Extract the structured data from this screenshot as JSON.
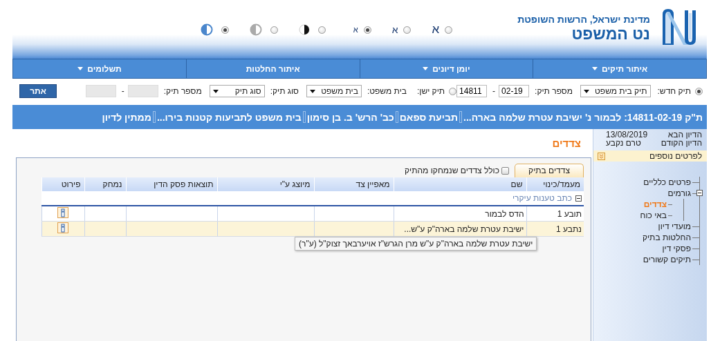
{
  "header": {
    "title": "נט המשפט",
    "subtitle": "מדינת ישראל, הרשות השופטת",
    "font_sizes": [
      {
        "label": "א",
        "kind": "large",
        "selected": false
      },
      {
        "label": "א",
        "kind": "medium",
        "selected": false
      },
      {
        "label": "א",
        "kind": "small",
        "selected": true
      }
    ],
    "contrast": [
      {
        "kind": "inverted",
        "selected": false
      },
      {
        "kind": "grayscale",
        "selected": false
      },
      {
        "kind": "normal",
        "selected": true
      }
    ]
  },
  "menu": [
    {
      "label": "איתור תיקים",
      "dropdown": true
    },
    {
      "label": "יומן דיונים",
      "dropdown": true
    },
    {
      "label": "איתור החלטות",
      "dropdown": false
    },
    {
      "label": "תשלומים",
      "dropdown": true
    }
  ],
  "search": {
    "items": [
      {
        "kind": "radio",
        "label": "תיק חדש:",
        "selected": true
      },
      {
        "kind": "select",
        "value": "תיק בית משפט"
      },
      {
        "kind": "label",
        "label": "מספר תיק:"
      },
      {
        "kind": "input",
        "value": "02-19",
        "disabled": false
      },
      {
        "kind": "label",
        "label": "-"
      },
      {
        "kind": "input",
        "value": "14811",
        "disabled": false
      },
      {
        "kind": "radio",
        "label": "תיק ישן:",
        "selected": false
      },
      {
        "kind": "label",
        "label": "בית משפט:"
      },
      {
        "kind": "select",
        "value": "בית משפט"
      },
      {
        "kind": "label",
        "label": "סוג תיק:"
      },
      {
        "kind": "select",
        "value": "סוג תיק"
      },
      {
        "kind": "label",
        "label": "מספר תיק:"
      },
      {
        "kind": "input",
        "value": "",
        "disabled": true
      },
      {
        "kind": "label",
        "label": "-"
      },
      {
        "kind": "input",
        "value": "",
        "disabled": true
      },
      {
        "kind": "button",
        "label": "אתר"
      }
    ]
  },
  "case_bar": [
    "ת\"ק 14811-02-19: לבמור נ' ישיבת עטרת שלמה בארה...",
    "תביעת ספאם",
    "כב' הרש' ב. בן סימון",
    "בית משפט לתביעות קטנות בירו...",
    "ממתין לדיון"
  ],
  "section_title": "צדדים",
  "tabs": [
    {
      "label": "צדדים בתיק",
      "selected": true
    }
  ],
  "include_deleted": {
    "label": "כולל צדדים שנמחקו מהתיק",
    "checked": false
  },
  "table": {
    "columns": [
      "מעמד/כינוי",
      "שם",
      "מאפיין צד",
      "מיוצג ע\"י",
      "תוצאות פסק הדין",
      "נמחק",
      "פירוט"
    ],
    "group": {
      "label": "כתב טענות עיקרי",
      "expanded": true
    },
    "rows": [
      {
        "role": "תובע 1",
        "name": "הדס לבמור",
        "selected": false
      },
      {
        "role": "נתבע 1",
        "name": "ישיבת עטרת שלמה בארה\"ק ע\"ש...",
        "selected": true
      }
    ]
  },
  "tooltip": "ישיבת עטרת שלמה בארה\"ק ע\"ש מרן הגרש\"ז אויערבאך זצוק\"ל (ע\"ר)",
  "sidebar": {
    "hearings": [
      {
        "label": "הדיון הבא",
        "value": "13/08/2019"
      },
      {
        "label": "הדיון הקודם",
        "value": "טרם נקבע"
      }
    ],
    "more_link": "לפרטים נוספים",
    "tree": [
      {
        "label": "פרטים כלליים",
        "selected": false
      },
      {
        "label": "גורמים",
        "selected": false,
        "expanded": true,
        "children": [
          {
            "label": "צדדים",
            "selected": true
          },
          {
            "label": "באי כוח",
            "selected": false
          }
        ]
      },
      {
        "label": "מועדי דיון",
        "selected": false
      },
      {
        "label": "החלטות בתיק",
        "selected": false
      },
      {
        "label": "פסקי דין",
        "selected": false
      },
      {
        "label": "תיקים קשורים",
        "selected": false
      }
    ]
  }
}
